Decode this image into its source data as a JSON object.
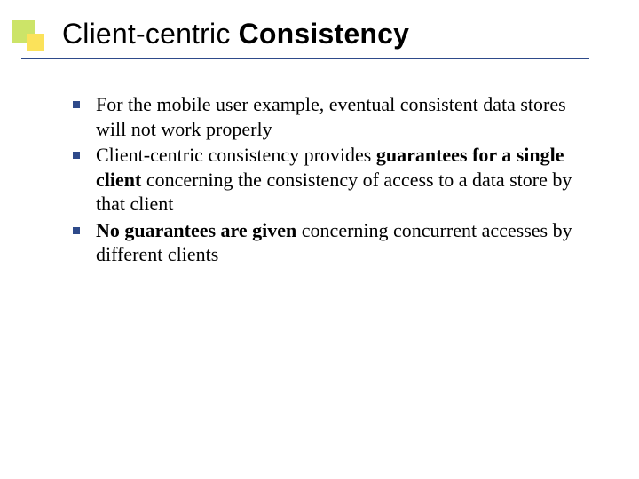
{
  "title": {
    "part1": "Client-centric ",
    "part2_bold": "Consistency"
  },
  "bullets": [
    {
      "runs": [
        {
          "t": "For the mobile user example, eventual consistent data stores will not work properly",
          "b": false
        }
      ]
    },
    {
      "runs": [
        {
          "t": "Client-centric consistency provides ",
          "b": false
        },
        {
          "t": "guarantees for a single client",
          "b": true
        },
        {
          "t": " concerning the consistency of access to a data store by that client",
          "b": false
        }
      ]
    },
    {
      "runs": [
        {
          "t": "No guarantees are given",
          "b": true
        },
        {
          "t": " concerning concurrent accesses by different clients",
          "b": false
        }
      ]
    }
  ]
}
